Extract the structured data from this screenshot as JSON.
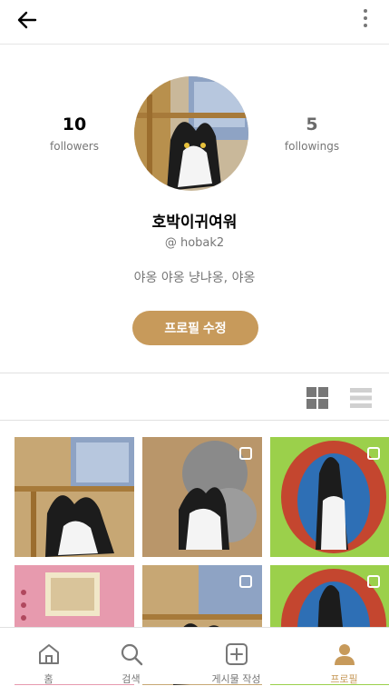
{
  "header": {
    "back_icon": "arrow-left-icon",
    "more_icon": "more-vertical-icon"
  },
  "profile": {
    "followers_count": "10",
    "followers_label": "followers",
    "followings_count": "5",
    "followings_label": "followings",
    "name": "호박이귀여워",
    "handle": "@ hobak2",
    "bio": "야옹 야옹 냥냐옹, 야옹",
    "edit_button": "프로필 수정"
  },
  "view_toggle": {
    "grid_icon": "grid-view-icon",
    "list_icon": "list-view-icon"
  },
  "posts": [
    {
      "type": "photo"
    },
    {
      "type": "multi-photo"
    },
    {
      "type": "multi-photo"
    },
    {
      "type": "photo"
    },
    {
      "type": "multi-photo"
    },
    {
      "type": "multi-photo"
    }
  ],
  "bottom_nav": [
    {
      "label": "홈",
      "icon": "home-icon"
    },
    {
      "label": "검색",
      "icon": "search-icon"
    },
    {
      "label": "게시물 작성",
      "icon": "plus-square-icon"
    },
    {
      "label": "프로필",
      "icon": "profile-icon",
      "active": true
    }
  ],
  "colors": {
    "accent": "#c79a5b",
    "muted": "#767676",
    "divider": "#e1e1e1"
  }
}
